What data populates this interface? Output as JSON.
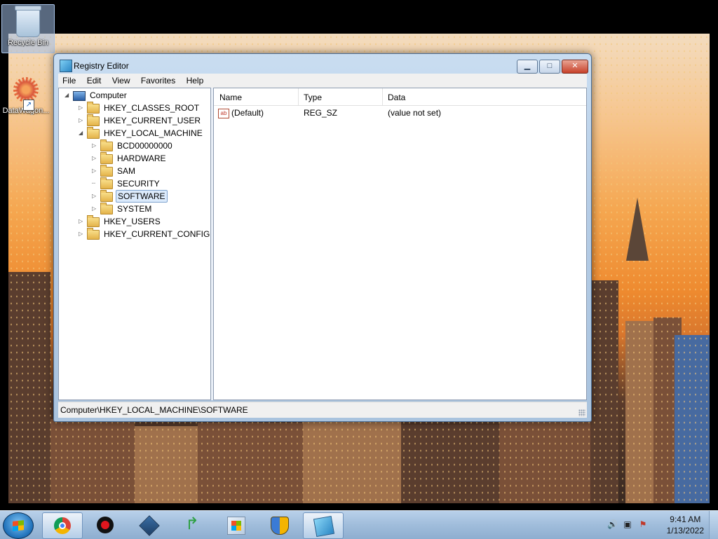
{
  "desktop": {
    "icons": [
      {
        "label": "Recycle Bin"
      },
      {
        "label": "DataWagon..."
      }
    ]
  },
  "window": {
    "title": "Registry Editor",
    "menu": [
      "File",
      "Edit",
      "View",
      "Favorites",
      "Help"
    ],
    "tree": {
      "root": "Computer",
      "hives": [
        {
          "label": "HKEY_CLASSES_ROOT"
        },
        {
          "label": "HKEY_CURRENT_USER"
        },
        {
          "label": "HKEY_LOCAL_MACHINE"
        },
        {
          "label": "HKEY_USERS"
        },
        {
          "label": "HKEY_CURRENT_CONFIG"
        }
      ],
      "hklm_children": [
        {
          "label": "BCD00000000"
        },
        {
          "label": "HARDWARE"
        },
        {
          "label": "SAM"
        },
        {
          "label": "SECURITY"
        },
        {
          "label": "SOFTWARE",
          "selected": true
        },
        {
          "label": "SYSTEM"
        }
      ]
    },
    "list": {
      "columns": [
        "Name",
        "Type",
        "Data"
      ],
      "rows": [
        {
          "name": "(Default)",
          "type": "REG_SZ",
          "data": "(value not set)"
        }
      ]
    },
    "status": "Computer\\HKEY_LOCAL_MACHINE\\SOFTWARE"
  },
  "taskbar": {
    "apps": [
      "chrome-icon",
      "record-icon",
      "virtualbox-icon",
      "green-arrow-icon",
      "store-icon",
      "shield-icon",
      "registry-editor-icon"
    ],
    "active_app": "registry-editor-icon",
    "clock": {
      "time": "9:41 AM",
      "date": "1/13/2022"
    }
  },
  "colors": {
    "accent": "#dcebfc",
    "taskbar": "#a0bddb",
    "window_frame": "#b6cde6"
  }
}
